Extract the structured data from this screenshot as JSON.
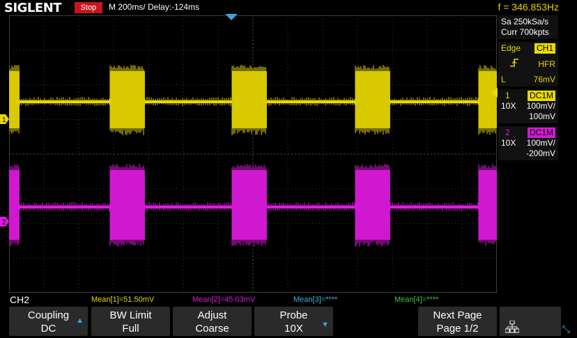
{
  "top": {
    "brand": "SIGLENT",
    "run_state": "Stop",
    "timebase": "M 200ms/  Delay:-124ms",
    "frequency": "f = 346.853Hz"
  },
  "acquisition": {
    "sample_rate": "Sa 250kSa/s",
    "memory": "Curr 700kpts"
  },
  "trigger": {
    "type": "Edge",
    "source": "CH1",
    "slope_icon": "rising-edge-icon",
    "mode": "HFR",
    "level_label": "L",
    "level": "76mV"
  },
  "channels": [
    {
      "number": "1",
      "coupling": "DC1M",
      "probe": "10X",
      "scale": "100mV/",
      "offset": "100mV",
      "color": "#e9d900"
    },
    {
      "number": "2",
      "coupling": "DC1M",
      "probe": "10X",
      "scale": "100mV/",
      "offset": "-200mV",
      "color": "#e01ae0"
    }
  ],
  "markers": {
    "ch1": "1",
    "ch2": "2"
  },
  "selected_channel": "CH2",
  "measurements": [
    {
      "label": "Mean[1]=51.50mV",
      "color": "#e9d900"
    },
    {
      "label": "Mean[2]=45.03mV",
      "color": "#e01ae0"
    },
    {
      "label": "Mean[3]=****",
      "color": "#3ab8d8"
    },
    {
      "label": "Mean[4]=****",
      "color": "#3ac43a"
    }
  ],
  "softkeys": [
    {
      "title": "Coupling",
      "value": "DC"
    },
    {
      "title": "BW Limit",
      "value": "Full"
    },
    {
      "title": "Adjust",
      "value": "Coarse"
    },
    {
      "title": "Probe",
      "value": "10X"
    },
    {
      "title": "Next Page",
      "value": "Page 1/2"
    }
  ],
  "icons": {
    "network": "network-icon",
    "expand": "expand-icon"
  }
}
